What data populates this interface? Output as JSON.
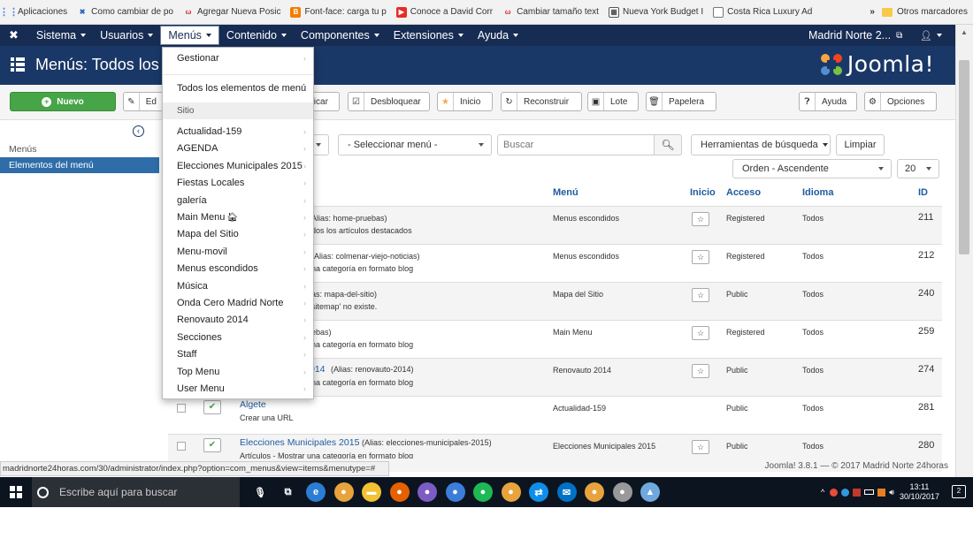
{
  "bookmarks": {
    "items": [
      "Aplicaciones",
      "Como cambiar de po",
      "Agregar Nueva Posic",
      "Font-face: carga tu p",
      "Conoce a David Corr",
      "Cambiar tamaño text",
      "Nueva York Budget I",
      "Costa Rica Luxury Ad"
    ],
    "more": "»",
    "others": "Otros marcadores"
  },
  "nav": {
    "items": [
      "Sistema",
      "Usuarios",
      "Menús",
      "Contenido",
      "Componentes",
      "Extensiones",
      "Ayuda"
    ],
    "site": "Madrid Norte 2...",
    "user_icon": "user-icon"
  },
  "header": {
    "title": "Menús: Todos los el",
    "brand": "Joomla!"
  },
  "toolbar": {
    "new": "Nuevo",
    "edit": "Ed",
    "publish": "blicar",
    "unlock": "Desbloquear",
    "home": "Inicio",
    "rebuild": "Reconstruir",
    "batch": "Lote",
    "trash": "Papelera",
    "help": "Ayuda",
    "options": "Opciones"
  },
  "sidebar": {
    "items": [
      "Menús",
      "Elementos del menú"
    ]
  },
  "filters": {
    "select_menu": "- Seleccionar menú -",
    "search_placeholder": "Buscar",
    "tools": "Herramientas de búsqueda",
    "clear": "Limpiar",
    "order": "Orden - Ascendente",
    "limit": "20"
  },
  "table": {
    "headers": {
      "menu": "Menú",
      "home": "Inicio",
      "access": "Acceso",
      "language": "Idioma",
      "id": "ID"
    },
    "rows": [
      {
        "t1": "Alias: home-pruebas)",
        "t2": "dos los artículos destacados",
        "menu": "Menus escondidos",
        "access": "Registered",
        "lang": "Todos",
        "id": "211"
      },
      {
        "t1": "(Alias: colmenar-viejo-noticias)",
        "t2": "na categoría en formato blog",
        "menu": "Menus escondidos",
        "access": "Registered",
        "lang": "Todos",
        "id": "212"
      },
      {
        "t1": "as: mapa-del-sitio)",
        "t2": "sitemap' no existe.",
        "menu": "Mapa del Sitio",
        "access": "Public",
        "lang": "Todos",
        "id": "240"
      },
      {
        "t1": "ebas)",
        "t2": "na categoría en formato blog",
        "menu": "Main Menu",
        "access": "Registered",
        "lang": "Todos",
        "id": "259"
      },
      {
        "t1": "014",
        "t1b": "(Alias: renovauto-2014)",
        "t2": "na categoría en formato blog",
        "menu": "Renovauto 2014",
        "access": "Public",
        "lang": "Todos",
        "id": "274"
      },
      {
        "t1": "Algete",
        "t2": "Crear una URL",
        "menu": "Actualidad-159",
        "access": "Public",
        "lang": "Todos",
        "id": "281"
      },
      {
        "t1": "Elecciones Municipales 2015",
        "t1b": "(Alias: elecciones-municipales-2015)",
        "t2": "Artículos - Mostrar una categoría en formato blog",
        "menu": "Elecciones Municipales 2015",
        "access": "Public",
        "lang": "Todos",
        "id": "280"
      }
    ]
  },
  "dropdown": {
    "manage": "Gestionar",
    "all_items": "Todos los elementos de menú",
    "site": "Sitio",
    "menus": [
      "Actualidad-159",
      "AGENDA",
      "Elecciones Municipales 2015",
      "Fiestas Locales",
      "galería",
      "Main Menu",
      "Mapa del Sitio",
      "Menu-movil",
      "Menus escondidos",
      "Música",
      "Onda Cero Madrid Norte",
      "Renovauto 2014",
      "Secciones",
      "Staff",
      "Top Menu",
      "User Menu"
    ]
  },
  "status": {
    "url": "madridnorte24horas.com/30/administrator/index.php?option=com_menus&view=items&menutype=#",
    "footer": "Joomla! 3.8.1 — © 2017 Madrid Norte 24horas"
  },
  "taskbar": {
    "search": "Escribe aquí para buscar",
    "time": "13:11",
    "date": "30/10/2017"
  }
}
